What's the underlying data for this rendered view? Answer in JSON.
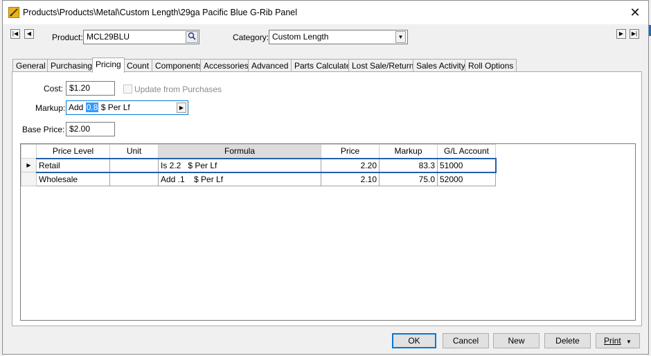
{
  "window": {
    "title": "Products\\Products\\Metal\\Custom Length\\29ga Pacific Blue G-Rib Panel",
    "close_icon": "close-icon",
    "app_icon": "pencil-ruler-icon"
  },
  "header": {
    "product_label": "Product:",
    "product_value": "MCL29BLU",
    "category_label": "Category:",
    "category_value": "Custom Length",
    "nav_icons": [
      "first-record-icon",
      "previous-record-icon",
      "next-record-icon",
      "last-record-icon"
    ]
  },
  "tabs": [
    {
      "label": "General"
    },
    {
      "label": "Purchasing"
    },
    {
      "label": "Pricing"
    },
    {
      "label": "Count"
    },
    {
      "label": "Components"
    },
    {
      "label": "Accessories"
    },
    {
      "label": "Advanced"
    },
    {
      "label": "Parts Calculate"
    },
    {
      "label": "Lost Sale/Return"
    },
    {
      "label": "Sales Activity"
    },
    {
      "label": "Roll Options"
    }
  ],
  "active_tab": "Pricing",
  "pricing": {
    "cost_label": "Cost:",
    "cost_value": "$1.20",
    "update_label": "Update from Purchases",
    "update_checked": false,
    "markup_label": "Markup:",
    "markup_prefix": "Add",
    "markup_selected": "0.8",
    "markup_suffix": "$ Per Lf",
    "base_price_label": "Base Price:",
    "base_price_value": "$2.00"
  },
  "grid": {
    "columns": [
      "Price Level",
      "Unit",
      "Formula",
      "Price",
      "Markup",
      "G/L Account"
    ],
    "rows": [
      {
        "level": "Retail",
        "unit": "",
        "formula": "Is 2.2   $ Per Lf",
        "price": "2.20",
        "markup": "83.3",
        "gl": "51000"
      },
      {
        "level": "Wholesale",
        "unit": "",
        "formula": "Add .1    $ Per Lf",
        "price": "2.10",
        "markup": "75.0",
        "gl": "52000"
      }
    ],
    "current_row_icon": "row-pointer-icon"
  },
  "buttons": {
    "ok": "OK",
    "cancel": "Cancel",
    "new": "New",
    "delete": "Delete",
    "print": "Print",
    "print_arrow": "▼"
  }
}
